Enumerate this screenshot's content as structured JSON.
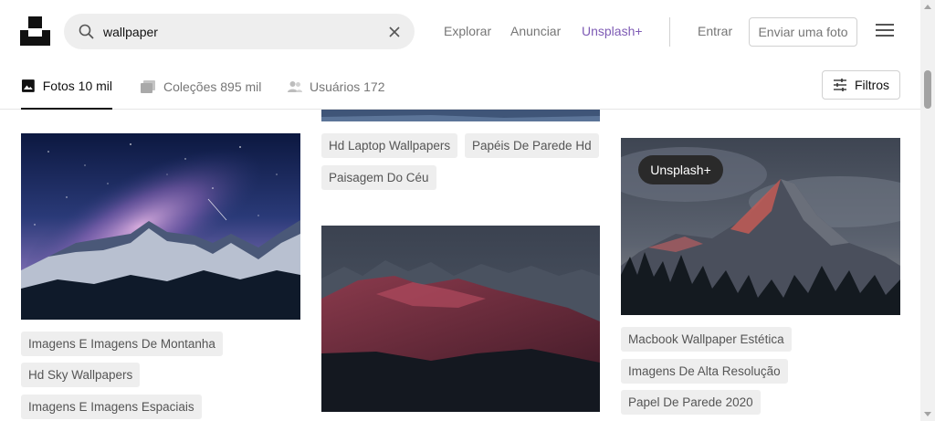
{
  "header": {
    "search_value": "wallpaper",
    "nav": {
      "explore": "Explorar",
      "advertise": "Anunciar",
      "plus": "Unsplash+",
      "login": "Entrar"
    },
    "submit_photo": "Enviar uma foto"
  },
  "tabs": {
    "photos": "Fotos 10 mil",
    "collections": "Coleções 895 mil",
    "users": "Usuários 172",
    "filters": "Filtros"
  },
  "columns": {
    "left": {
      "tags": [
        "Imagens E Imagens De Montanha",
        "Hd Sky Wallpapers",
        "Imagens E Imagens Espaciais"
      ]
    },
    "middle": {
      "tags": [
        "Hd Laptop Wallpapers",
        "Papéis De Parede Hd",
        "Paisagem Do Céu"
      ]
    },
    "right": {
      "badge": "Unsplash+",
      "tags": [
        "Macbook Wallpaper Estética",
        "Imagens De Alta Resolução",
        "Papel De Parede 2020"
      ]
    }
  }
}
